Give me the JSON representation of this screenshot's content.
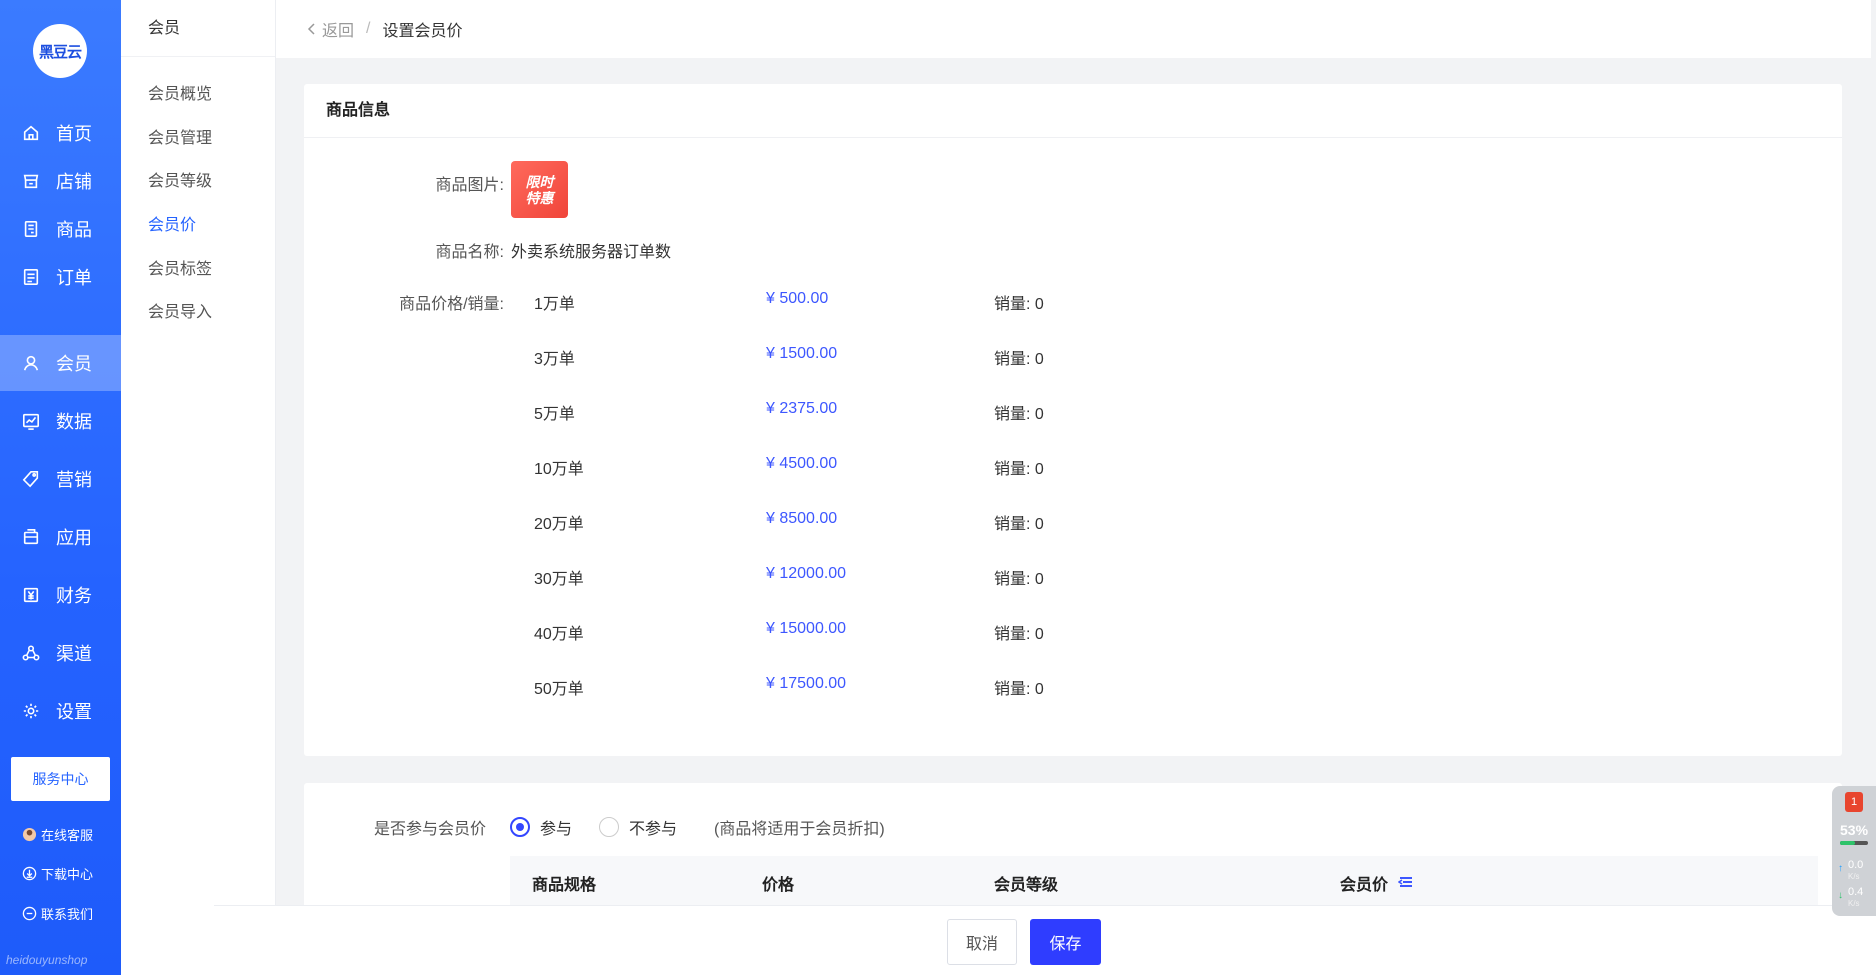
{
  "sidebar": {
    "logo_text": "黑豆云",
    "items": [
      {
        "label": "首页",
        "icon": "home-icon"
      },
      {
        "label": "店铺",
        "icon": "store-icon"
      },
      {
        "label": "商品",
        "icon": "goods-icon"
      },
      {
        "label": "订单",
        "icon": "order-icon"
      },
      {
        "label": "会员",
        "icon": "user-icon",
        "active": true
      },
      {
        "label": "数据",
        "icon": "chart-icon"
      },
      {
        "label": "营销",
        "icon": "tag-icon"
      },
      {
        "label": "应用",
        "icon": "app-icon"
      },
      {
        "label": "财务",
        "icon": "finance-icon"
      },
      {
        "label": "渠道",
        "icon": "channel-icon"
      },
      {
        "label": "设置",
        "icon": "gear-icon"
      }
    ],
    "service_button": "服务中心",
    "links": [
      "在线客服",
      "下载中心",
      "联系我们"
    ],
    "footer_brand": "heidouyunshop"
  },
  "subnav": {
    "title": "会员",
    "items": [
      "会员概览",
      "会员管理",
      "会员等级",
      "会员价",
      "会员标签",
      "会员导入"
    ],
    "active_index": 3
  },
  "breadcrumb": {
    "back": "返回",
    "separator": "/",
    "current": "设置会员价"
  },
  "product": {
    "section_title": "商品信息",
    "image_label": "商品图片:",
    "image_text": [
      "限时",
      "特惠"
    ],
    "name_label": "商品名称:",
    "name": "外卖系统服务器订单数",
    "price_label": "商品价格/销量:",
    "specs": [
      {
        "spec": "1万单",
        "price": "¥ 500.00",
        "sales": "销量: 0"
      },
      {
        "spec": "3万单",
        "price": "¥ 1500.00",
        "sales": "销量: 0"
      },
      {
        "spec": "5万单",
        "price": "¥ 2375.00",
        "sales": "销量: 0"
      },
      {
        "spec": "10万单",
        "price": "¥ 4500.00",
        "sales": "销量: 0"
      },
      {
        "spec": "20万单",
        "price": "¥ 8500.00",
        "sales": "销量: 0"
      },
      {
        "spec": "30万单",
        "price": "¥ 12000.00",
        "sales": "销量: 0"
      },
      {
        "spec": "40万单",
        "price": "¥ 15000.00",
        "sales": "销量: 0"
      },
      {
        "spec": "50万单",
        "price": "¥ 17500.00",
        "sales": "销量: 0"
      }
    ]
  },
  "member_price": {
    "participate_label": "是否参与会员价",
    "option_yes": "参与",
    "option_no": "不参与",
    "note": "(商品将适用于会员折扣)",
    "selected": "参与",
    "table_headers": [
      "商品规格",
      "价格",
      "会员等级",
      "会员价"
    ]
  },
  "actions": {
    "cancel": "取消",
    "save": "保存"
  },
  "widget": {
    "badge": "1",
    "percent": "53%",
    "upload": "0.0",
    "download": "0.4",
    "unit": "K/s"
  },
  "colors": {
    "sidebar": "#2563ff",
    "accent": "#3d57ff",
    "save_button": "#2f3dff"
  }
}
